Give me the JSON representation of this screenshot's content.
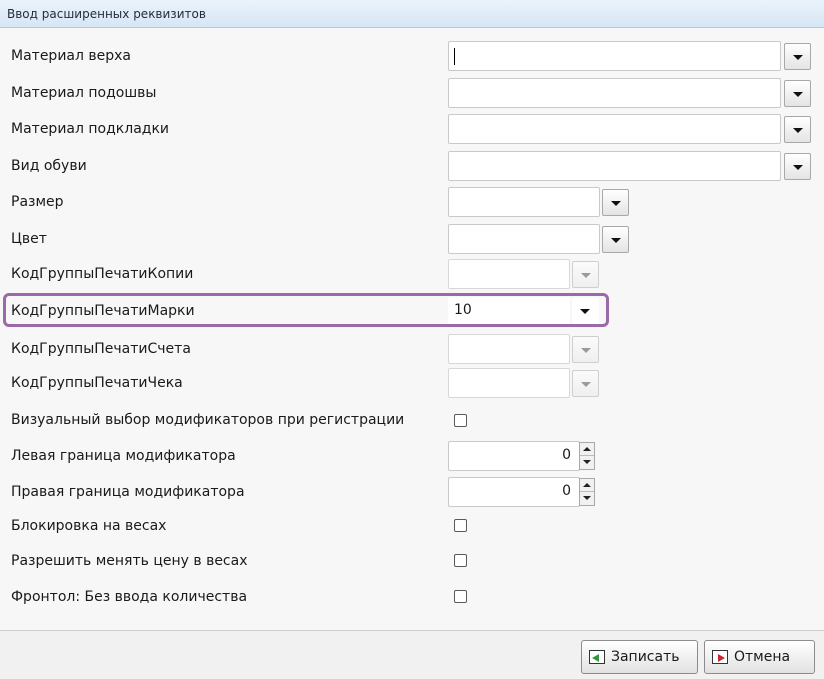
{
  "window": {
    "title": "Ввод расширенных реквизитов"
  },
  "fields": [
    {
      "label": "Материал верха",
      "value": ""
    },
    {
      "label": "Материал подошвы",
      "value": ""
    },
    {
      "label": "Материал подкладки",
      "value": ""
    },
    {
      "label": "Вид обуви",
      "value": ""
    },
    {
      "label": "Размер",
      "value": ""
    },
    {
      "label": "Цвет",
      "value": ""
    },
    {
      "label": "КодГруппыПечатиКопии",
      "value": ""
    },
    {
      "label": "КодГруппыПечатиМарки",
      "value": "10"
    },
    {
      "label": "КодГруппыПечатиСчета",
      "value": ""
    },
    {
      "label": "КодГруппыПечатиЧека",
      "value": ""
    }
  ],
  "visual_choice": {
    "label": "Визуальный выбор модификаторов при регистрации",
    "checked": false
  },
  "left_bound": {
    "label": "Левая граница модификатора",
    "value": "0"
  },
  "right_bound": {
    "label": "Правая граница модификатора",
    "value": "0"
  },
  "checks": [
    {
      "label": "Блокировка на весах",
      "checked": false
    },
    {
      "label": "Разрешить менять цену в весах",
      "checked": false
    },
    {
      "label": "Фронтол: Без ввода количества",
      "checked": false
    }
  ],
  "footer": {
    "save_label": "Записать",
    "cancel_label": "Отмена"
  },
  "colors": {
    "highlight": "#9b68a8",
    "save_icon": "#2c9a37",
    "cancel_icon": "#c8262b"
  }
}
